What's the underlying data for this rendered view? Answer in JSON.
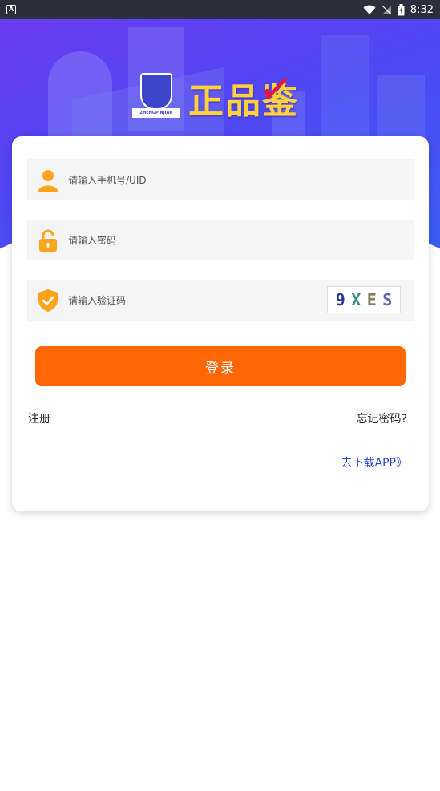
{
  "status_bar": {
    "left_badge": "A",
    "time": "8:32"
  },
  "logo": {
    "emblem_text": "ZHENGPINJIAN",
    "title": "正品鉴"
  },
  "form": {
    "phone_placeholder": "请输入手机号/UID",
    "password_placeholder": "请输入密码",
    "captcha_placeholder": "请输入验证码",
    "captcha_chars": [
      "9",
      "X",
      "E",
      "S"
    ],
    "login_label": "登录"
  },
  "links": {
    "register": "注册",
    "forgot_password": "忘记密码?",
    "download_app": "去下载APP》"
  },
  "icons": {
    "user": "user-icon",
    "lock": "lock-icon",
    "shield": "shield-check-icon"
  },
  "colors": {
    "accent": "#ff6706",
    "icon_orange": "#ffa31a",
    "banner_start": "#6a3cf0",
    "banner_end": "#3a5df5",
    "link_blue": "#2346d8",
    "logo_yellow": "#ffd23a",
    "check_red": "#e8163a"
  }
}
